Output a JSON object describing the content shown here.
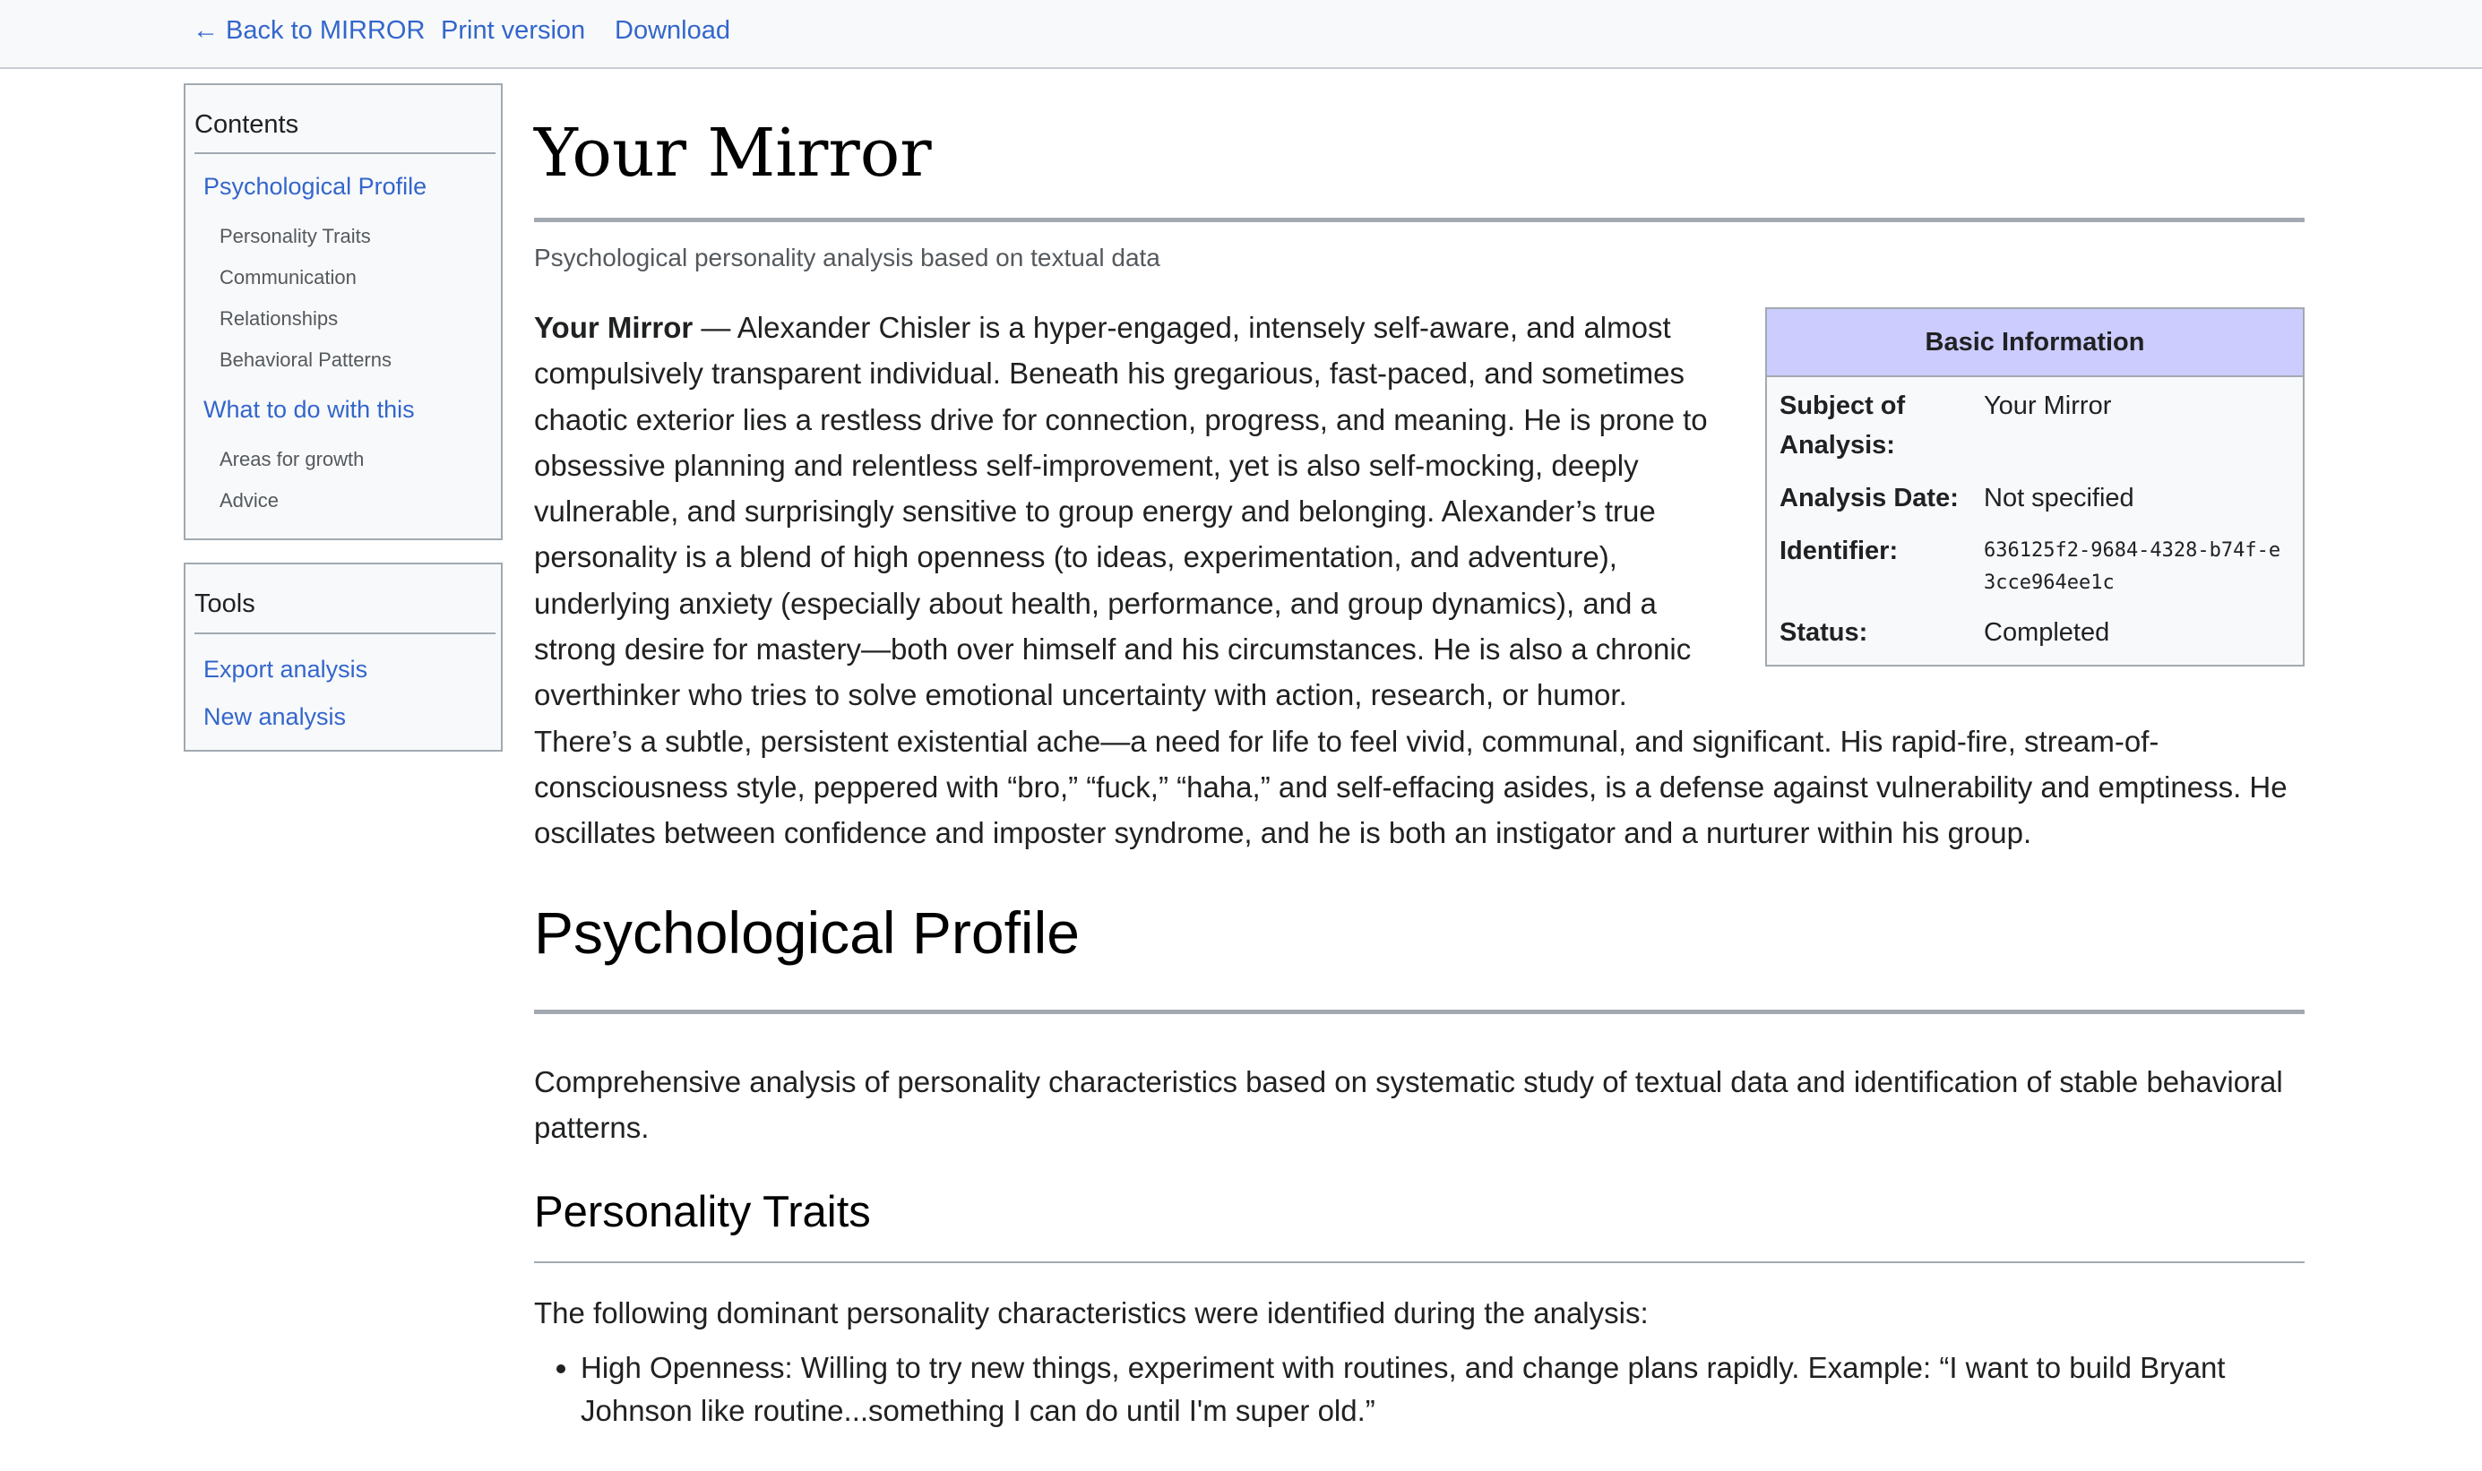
{
  "topbar": {
    "back_label": "← Back to MIRROR",
    "print_label": "Print version",
    "download_label": "Download"
  },
  "contents": {
    "title": "Contents",
    "sections": [
      {
        "label": "Psychological Profile",
        "items": [
          "Personality Traits",
          "Communication",
          "Relationships",
          "Behavioral Patterns"
        ]
      },
      {
        "label": "What to do with this",
        "items": [
          "Areas for growth",
          "Advice"
        ]
      }
    ]
  },
  "tools": {
    "title": "Tools",
    "items": [
      "Export analysis",
      "New analysis"
    ]
  },
  "page": {
    "title": "Your Mirror",
    "subtitle": "Psychological personality analysis based on textual data",
    "intro_bold": "Your Mirror",
    "intro_text": " — Alexander Chisler is a hyper-engaged, intensely self-aware, and almost compulsively transparent individual. Beneath his gregarious, fast-paced, and sometimes chaotic exterior lies a restless drive for connection, progress, and meaning. He is prone to obsessive planning and relentless self-improvement, yet is also self-mocking, deeply vulnerable, and surprisingly sensitive to group energy and belonging. Alexander’s true personality is a blend of high openness (to ideas, experimentation, and adventure), underlying anxiety (especially about health, performance, and group dynamics), and a strong desire for mastery—both over himself and his circumstances. He is also a chronic overthinker who tries to solve emotional uncertainty with action, research, or humor. There’s a subtle, persistent existential ache—a need for life to feel vivid, communal, and significant. His rapid-fire, stream-of-consciousness style, peppered with “bro,” “fuck,” “haha,” and self-effacing asides, is a defense against vulnerability and emptiness. He oscillates between confidence and imposter syndrome, and he is both an instigator and a nurturer within his group."
  },
  "infobox": {
    "title": "Basic Information",
    "rows": [
      {
        "label": "Subject of Analysis:",
        "value": "Your Mirror"
      },
      {
        "label": "Analysis Date:",
        "value": "Not specified"
      },
      {
        "label": "Identifier:",
        "value": "636125f2-9684-4328-b74f-e3cce964ee1c"
      },
      {
        "label": "Status:",
        "value": "Completed"
      }
    ]
  },
  "profile": {
    "heading": "Psychological Profile",
    "description": "Comprehensive analysis of personality characteristics based on systematic study of textual data and identification of stable behavioral patterns."
  },
  "traits": {
    "heading": "Personality Traits",
    "intro": "The following dominant personality characteristics were identified during the analysis:",
    "items": [
      "High Openness: Willing to try new things, experiment with routines, and change plans rapidly. Example: “I want to build Bryant Johnson like routine...something I can do until I'm super old.”"
    ]
  },
  "colors": {
    "link": "#3366cc",
    "infobox_header": "#ccccff",
    "border": "#a2a9b1",
    "panel_bg": "#f8f9fa"
  }
}
